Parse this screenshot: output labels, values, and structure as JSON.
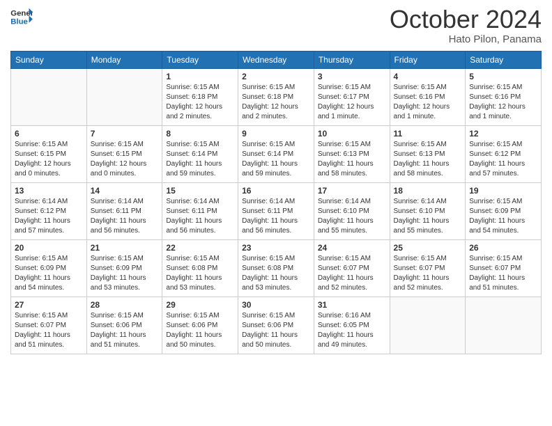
{
  "header": {
    "logo_general": "General",
    "logo_blue": "Blue",
    "month_title": "October 2024",
    "location": "Hato Pilon, Panama"
  },
  "weekdays": [
    "Sunday",
    "Monday",
    "Tuesday",
    "Wednesday",
    "Thursday",
    "Friday",
    "Saturday"
  ],
  "weeks": [
    [
      {
        "day": "",
        "empty": true
      },
      {
        "day": "",
        "empty": true
      },
      {
        "day": "1",
        "sunrise": "Sunrise: 6:15 AM",
        "sunset": "Sunset: 6:18 PM",
        "daylight": "Daylight: 12 hours and 2 minutes."
      },
      {
        "day": "2",
        "sunrise": "Sunrise: 6:15 AM",
        "sunset": "Sunset: 6:18 PM",
        "daylight": "Daylight: 12 hours and 2 minutes."
      },
      {
        "day": "3",
        "sunrise": "Sunrise: 6:15 AM",
        "sunset": "Sunset: 6:17 PM",
        "daylight": "Daylight: 12 hours and 1 minute."
      },
      {
        "day": "4",
        "sunrise": "Sunrise: 6:15 AM",
        "sunset": "Sunset: 6:16 PM",
        "daylight": "Daylight: 12 hours and 1 minute."
      },
      {
        "day": "5",
        "sunrise": "Sunrise: 6:15 AM",
        "sunset": "Sunset: 6:16 PM",
        "daylight": "Daylight: 12 hours and 1 minute."
      }
    ],
    [
      {
        "day": "6",
        "sunrise": "Sunrise: 6:15 AM",
        "sunset": "Sunset: 6:15 PM",
        "daylight": "Daylight: 12 hours and 0 minutes."
      },
      {
        "day": "7",
        "sunrise": "Sunrise: 6:15 AM",
        "sunset": "Sunset: 6:15 PM",
        "daylight": "Daylight: 12 hours and 0 minutes."
      },
      {
        "day": "8",
        "sunrise": "Sunrise: 6:15 AM",
        "sunset": "Sunset: 6:14 PM",
        "daylight": "Daylight: 11 hours and 59 minutes."
      },
      {
        "day": "9",
        "sunrise": "Sunrise: 6:15 AM",
        "sunset": "Sunset: 6:14 PM",
        "daylight": "Daylight: 11 hours and 59 minutes."
      },
      {
        "day": "10",
        "sunrise": "Sunrise: 6:15 AM",
        "sunset": "Sunset: 6:13 PM",
        "daylight": "Daylight: 11 hours and 58 minutes."
      },
      {
        "day": "11",
        "sunrise": "Sunrise: 6:15 AM",
        "sunset": "Sunset: 6:13 PM",
        "daylight": "Daylight: 11 hours and 58 minutes."
      },
      {
        "day": "12",
        "sunrise": "Sunrise: 6:15 AM",
        "sunset": "Sunset: 6:12 PM",
        "daylight": "Daylight: 11 hours and 57 minutes."
      }
    ],
    [
      {
        "day": "13",
        "sunrise": "Sunrise: 6:14 AM",
        "sunset": "Sunset: 6:12 PM",
        "daylight": "Daylight: 11 hours and 57 minutes."
      },
      {
        "day": "14",
        "sunrise": "Sunrise: 6:14 AM",
        "sunset": "Sunset: 6:11 PM",
        "daylight": "Daylight: 11 hours and 56 minutes."
      },
      {
        "day": "15",
        "sunrise": "Sunrise: 6:14 AM",
        "sunset": "Sunset: 6:11 PM",
        "daylight": "Daylight: 11 hours and 56 minutes."
      },
      {
        "day": "16",
        "sunrise": "Sunrise: 6:14 AM",
        "sunset": "Sunset: 6:11 PM",
        "daylight": "Daylight: 11 hours and 56 minutes."
      },
      {
        "day": "17",
        "sunrise": "Sunrise: 6:14 AM",
        "sunset": "Sunset: 6:10 PM",
        "daylight": "Daylight: 11 hours and 55 minutes."
      },
      {
        "day": "18",
        "sunrise": "Sunrise: 6:14 AM",
        "sunset": "Sunset: 6:10 PM",
        "daylight": "Daylight: 11 hours and 55 minutes."
      },
      {
        "day": "19",
        "sunrise": "Sunrise: 6:15 AM",
        "sunset": "Sunset: 6:09 PM",
        "daylight": "Daylight: 11 hours and 54 minutes."
      }
    ],
    [
      {
        "day": "20",
        "sunrise": "Sunrise: 6:15 AM",
        "sunset": "Sunset: 6:09 PM",
        "daylight": "Daylight: 11 hours and 54 minutes."
      },
      {
        "day": "21",
        "sunrise": "Sunrise: 6:15 AM",
        "sunset": "Sunset: 6:09 PM",
        "daylight": "Daylight: 11 hours and 53 minutes."
      },
      {
        "day": "22",
        "sunrise": "Sunrise: 6:15 AM",
        "sunset": "Sunset: 6:08 PM",
        "daylight": "Daylight: 11 hours and 53 minutes."
      },
      {
        "day": "23",
        "sunrise": "Sunrise: 6:15 AM",
        "sunset": "Sunset: 6:08 PM",
        "daylight": "Daylight: 11 hours and 53 minutes."
      },
      {
        "day": "24",
        "sunrise": "Sunrise: 6:15 AM",
        "sunset": "Sunset: 6:07 PM",
        "daylight": "Daylight: 11 hours and 52 minutes."
      },
      {
        "day": "25",
        "sunrise": "Sunrise: 6:15 AM",
        "sunset": "Sunset: 6:07 PM",
        "daylight": "Daylight: 11 hours and 52 minutes."
      },
      {
        "day": "26",
        "sunrise": "Sunrise: 6:15 AM",
        "sunset": "Sunset: 6:07 PM",
        "daylight": "Daylight: 11 hours and 51 minutes."
      }
    ],
    [
      {
        "day": "27",
        "sunrise": "Sunrise: 6:15 AM",
        "sunset": "Sunset: 6:07 PM",
        "daylight": "Daylight: 11 hours and 51 minutes."
      },
      {
        "day": "28",
        "sunrise": "Sunrise: 6:15 AM",
        "sunset": "Sunset: 6:06 PM",
        "daylight": "Daylight: 11 hours and 51 minutes."
      },
      {
        "day": "29",
        "sunrise": "Sunrise: 6:15 AM",
        "sunset": "Sunset: 6:06 PM",
        "daylight": "Daylight: 11 hours and 50 minutes."
      },
      {
        "day": "30",
        "sunrise": "Sunrise: 6:15 AM",
        "sunset": "Sunset: 6:06 PM",
        "daylight": "Daylight: 11 hours and 50 minutes."
      },
      {
        "day": "31",
        "sunrise": "Sunrise: 6:16 AM",
        "sunset": "Sunset: 6:05 PM",
        "daylight": "Daylight: 11 hours and 49 minutes."
      },
      {
        "day": "",
        "empty": true
      },
      {
        "day": "",
        "empty": true
      }
    ]
  ]
}
